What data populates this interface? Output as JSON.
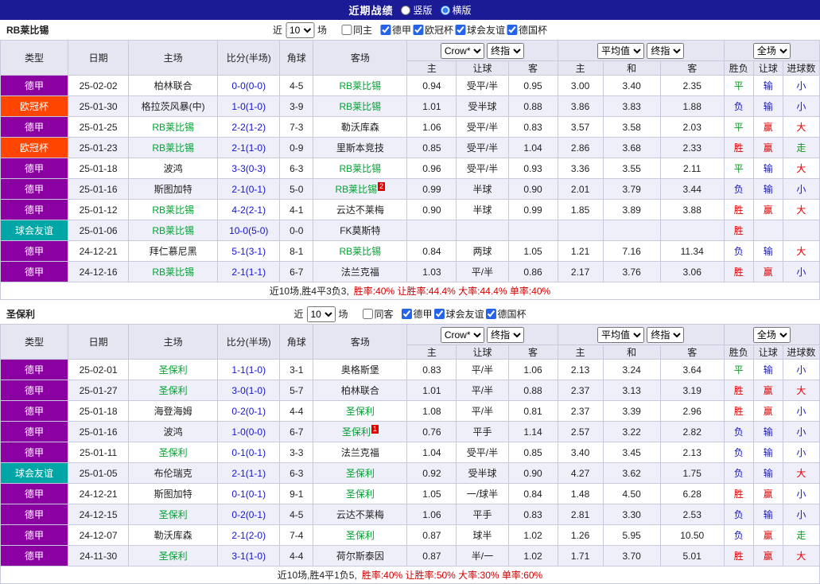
{
  "topbar": {
    "title": "近期战绩",
    "options": [
      {
        "label": "竖版",
        "selected": false
      },
      {
        "label": "横版",
        "selected": true
      }
    ]
  },
  "colors": {
    "badge": {
      "德甲": "#8B00A0",
      "欧冠杯": "#FF4500",
      "球会友谊": "#00A5A5",
      "德国杯": "#3355AA"
    },
    "css": {
      "topbar": "#1B1B96",
      "headbg": "#E6E6F3",
      "altbg": "#EFEFFA",
      "border": "#C9C9DD",
      "win": "#E00000",
      "lose": "#1515C8",
      "draw": "#089B20",
      "team": "#00A030",
      "score": "#1414CC",
      "summary": "#D00000"
    }
  },
  "table_header": {
    "cols": [
      "类型",
      "日期",
      "主场",
      "比分(半场)",
      "角球",
      "客场"
    ],
    "sub": [
      "主",
      "让球",
      "客",
      "主",
      "和",
      "客",
      "胜负",
      "让球",
      "进球数"
    ],
    "selects": {
      "odds_source": "Crow*",
      "odds_time": "终指",
      "euro_source": "平均值",
      "euro_time": "终指",
      "scope": "全场"
    }
  },
  "sections": [
    {
      "team": "RB莱比锡",
      "filter": {
        "near": "近",
        "count": "10",
        "unit": "场",
        "same": {
          "label": "同主",
          "checked": false
        },
        "leagues": [
          {
            "label": "德甲",
            "checked": true
          },
          {
            "label": "欧冠杯",
            "checked": true
          },
          {
            "label": "球会友谊",
            "checked": true
          },
          {
            "label": "德国杯",
            "checked": true
          }
        ]
      },
      "rows": [
        {
          "league": "德甲",
          "date": "25-02-02",
          "home": "柏林联合",
          "score": "0-0(0-0)",
          "corners": "4-5",
          "away": "RB莱比锡",
          "away_self": true,
          "odds": [
            "0.94",
            "受平/半",
            "0.95",
            "3.00",
            "3.40",
            "2.35"
          ],
          "res": [
            "平",
            "输",
            "小"
          ]
        },
        {
          "league": "欧冠杯",
          "date": "25-01-30",
          "home": "格拉茨风暴(中)",
          "score": "1-0(1-0)",
          "corners": "3-9",
          "away": "RB莱比锡",
          "away_self": true,
          "odds": [
            "1.01",
            "受半球",
            "0.88",
            "3.86",
            "3.83",
            "1.88"
          ],
          "res": [
            "负",
            "输",
            "小"
          ]
        },
        {
          "league": "德甲",
          "date": "25-01-25",
          "home": "RB莱比锡",
          "home_self": true,
          "score": "2-2(1-2)",
          "corners": "7-3",
          "away": "勒沃库森",
          "odds": [
            "1.06",
            "受平/半",
            "0.83",
            "3.57",
            "3.58",
            "2.03"
          ],
          "res": [
            "平",
            "赢",
            "大"
          ]
        },
        {
          "league": "欧冠杯",
          "date": "25-01-23",
          "home": "RB莱比锡",
          "home_self": true,
          "score": "2-1(1-0)",
          "corners": "0-9",
          "away": "里斯本竞技",
          "odds": [
            "0.85",
            "受平/半",
            "1.04",
            "2.86",
            "3.68",
            "2.33"
          ],
          "res": [
            "胜",
            "赢",
            "走"
          ]
        },
        {
          "league": "德甲",
          "date": "25-01-18",
          "home": "波鸿",
          "score": "3-3(0-3)",
          "corners": "6-3",
          "away": "RB莱比锡",
          "away_self": true,
          "odds": [
            "0.96",
            "受平/半",
            "0.93",
            "3.36",
            "3.55",
            "2.11"
          ],
          "res": [
            "平",
            "输",
            "大"
          ]
        },
        {
          "league": "德甲",
          "date": "25-01-16",
          "home": "斯图加特",
          "score": "2-1(0-1)",
          "corners": "5-0",
          "away": "RB莱比锡",
          "away_self": true,
          "away_card": "2",
          "odds": [
            "0.99",
            "半球",
            "0.90",
            "2.01",
            "3.79",
            "3.44"
          ],
          "res": [
            "负",
            "输",
            "小"
          ]
        },
        {
          "league": "德甲",
          "date": "25-01-12",
          "home": "RB莱比锡",
          "home_self": true,
          "score": "4-2(2-1)",
          "corners": "4-1",
          "away": "云达不莱梅",
          "odds": [
            "0.90",
            "半球",
            "0.99",
            "1.85",
            "3.89",
            "3.88"
          ],
          "res": [
            "胜",
            "赢",
            "大"
          ]
        },
        {
          "league": "球会友谊",
          "date": "25-01-06",
          "home": "RB莱比锡",
          "home_self": true,
          "score": "10-0(5-0)",
          "corners": "0-0",
          "away": "FK莫斯特",
          "odds": [
            "",
            "",
            "",
            "",
            "",
            ""
          ],
          "res": [
            "胜",
            "",
            ""
          ]
        },
        {
          "league": "德甲",
          "date": "24-12-21",
          "home": "拜仁慕尼黑",
          "score": "5-1(3-1)",
          "corners": "8-1",
          "away": "RB莱比锡",
          "away_self": true,
          "odds": [
            "0.84",
            "两球",
            "1.05",
            "1.21",
            "7.16",
            "11.34"
          ],
          "res": [
            "负",
            "输",
            "大"
          ]
        },
        {
          "league": "德甲",
          "date": "24-12-16",
          "home": "RB莱比锡",
          "home_self": true,
          "score": "2-1(1-1)",
          "corners": "6-7",
          "away": "法兰克福",
          "odds": [
            "1.03",
            "平/半",
            "0.86",
            "2.17",
            "3.76",
            "3.06"
          ],
          "res": [
            "胜",
            "赢",
            "小"
          ]
        }
      ],
      "summary": {
        "prefix": "近10场,胜4平3负3,",
        "stats": "胜率:40% 让胜率:44.4% 大率:44.4% 单率:40%"
      }
    },
    {
      "team": "圣保利",
      "filter": {
        "near": "近",
        "count": "10",
        "unit": "场",
        "same": {
          "label": "同客",
          "checked": false
        },
        "leagues": [
          {
            "label": "德甲",
            "checked": true
          },
          {
            "label": "球会友谊",
            "checked": true
          },
          {
            "label": "德国杯",
            "checked": true
          }
        ]
      },
      "rows": [
        {
          "league": "德甲",
          "date": "25-02-01",
          "home": "圣保利",
          "home_self": true,
          "score": "1-1(1-0)",
          "corners": "3-1",
          "away": "奥格斯堡",
          "odds": [
            "0.83",
            "平/半",
            "1.06",
            "2.13",
            "3.24",
            "3.64"
          ],
          "res": [
            "平",
            "输",
            "小"
          ]
        },
        {
          "league": "德甲",
          "date": "25-01-27",
          "home": "圣保利",
          "home_self": true,
          "score": "3-0(1-0)",
          "corners": "5-7",
          "away": "柏林联合",
          "odds": [
            "1.01",
            "平/半",
            "0.88",
            "2.37",
            "3.13",
            "3.19"
          ],
          "res": [
            "胜",
            "赢",
            "大"
          ]
        },
        {
          "league": "德甲",
          "date": "25-01-18",
          "home": "海登海姆",
          "score": "0-2(0-1)",
          "corners": "4-4",
          "away": "圣保利",
          "away_self": true,
          "odds": [
            "1.08",
            "平/半",
            "0.81",
            "2.37",
            "3.39",
            "2.96"
          ],
          "res": [
            "胜",
            "赢",
            "小"
          ]
        },
        {
          "league": "德甲",
          "date": "25-01-16",
          "home": "波鸿",
          "score": "1-0(0-0)",
          "corners": "6-7",
          "away": "圣保利",
          "away_self": true,
          "away_card": "1",
          "odds": [
            "0.76",
            "平手",
            "1.14",
            "2.57",
            "3.22",
            "2.82"
          ],
          "res": [
            "负",
            "输",
            "小"
          ]
        },
        {
          "league": "德甲",
          "date": "25-01-11",
          "home": "圣保利",
          "home_self": true,
          "score": "0-1(0-1)",
          "corners": "3-3",
          "away": "法兰克福",
          "odds": [
            "1.04",
            "受平/半",
            "0.85",
            "3.40",
            "3.45",
            "2.13"
          ],
          "res": [
            "负",
            "输",
            "小"
          ]
        },
        {
          "league": "球会友谊",
          "date": "25-01-05",
          "home": "布伦瑞克",
          "score": "2-1(1-1)",
          "corners": "6-3",
          "away": "圣保利",
          "away_self": true,
          "odds": [
            "0.92",
            "受半球",
            "0.90",
            "4.27",
            "3.62",
            "1.75"
          ],
          "res": [
            "负",
            "输",
            "大"
          ]
        },
        {
          "league": "德甲",
          "date": "24-12-21",
          "home": "斯图加特",
          "score": "0-1(0-1)",
          "corners": "9-1",
          "away": "圣保利",
          "away_self": true,
          "odds": [
            "1.05",
            "一/球半",
            "0.84",
            "1.48",
            "4.50",
            "6.28"
          ],
          "res": [
            "胜",
            "赢",
            "小"
          ]
        },
        {
          "league": "德甲",
          "date": "24-12-15",
          "home": "圣保利",
          "home_self": true,
          "score": "0-2(0-1)",
          "corners": "4-5",
          "away": "云达不莱梅",
          "odds": [
            "1.06",
            "平手",
            "0.83",
            "2.81",
            "3.30",
            "2.53"
          ],
          "res": [
            "负",
            "输",
            "小"
          ]
        },
        {
          "league": "德甲",
          "date": "24-12-07",
          "home": "勒沃库森",
          "score": "2-1(2-0)",
          "corners": "7-4",
          "away": "圣保利",
          "away_self": true,
          "odds": [
            "0.87",
            "球半",
            "1.02",
            "1.26",
            "5.95",
            "10.50"
          ],
          "res": [
            "负",
            "赢",
            "走"
          ]
        },
        {
          "league": "德甲",
          "date": "24-11-30",
          "home": "圣保利",
          "home_self": true,
          "score": "3-1(1-0)",
          "corners": "4-4",
          "away": "荷尔斯泰因",
          "odds": [
            "0.87",
            "半/一",
            "1.02",
            "1.71",
            "3.70",
            "5.01"
          ],
          "res": [
            "胜",
            "赢",
            "大"
          ]
        }
      ],
      "summary": {
        "prefix": "近10场,胜4平1负5,",
        "stats": "胜率:40% 让胜率:50% 大率:30% 单率:60%"
      }
    }
  ]
}
